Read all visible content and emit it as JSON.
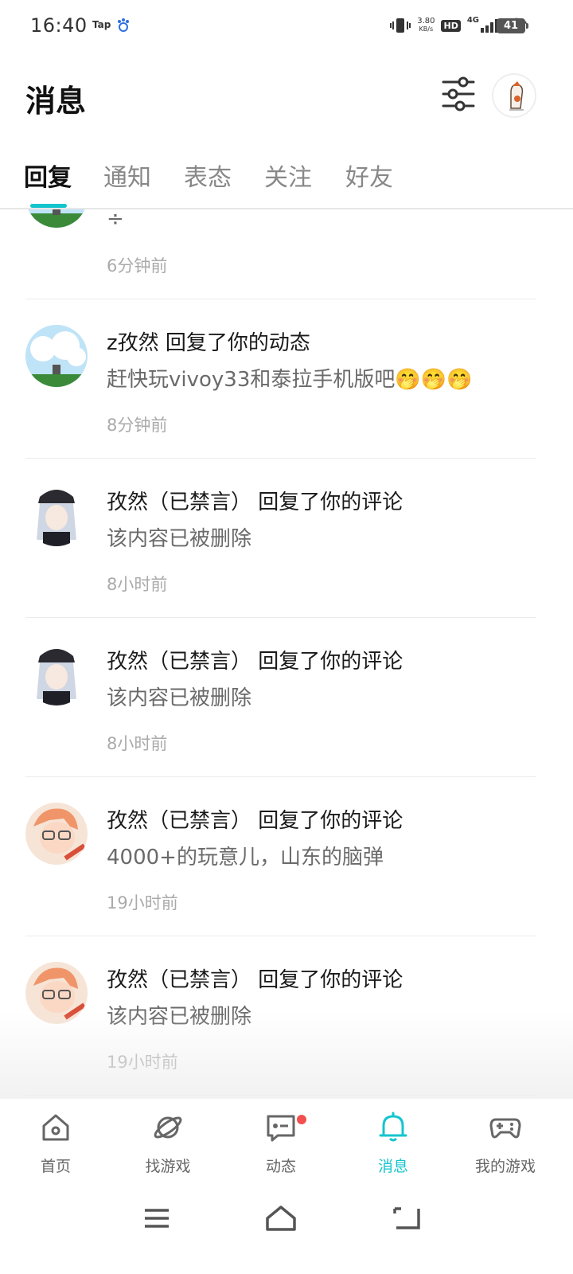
{
  "status_bar": {
    "time": "16:40",
    "tap_label": "Tap",
    "speed_value": "3.80",
    "speed_unit": "KB/s",
    "hd": "HD",
    "network": "4G",
    "battery": "41"
  },
  "header": {
    "title": "消息"
  },
  "tabs": [
    "回复",
    "通知",
    "表态",
    "关注",
    "好友"
  ],
  "messages": [
    {
      "title": "",
      "body": "÷",
      "time": "6分钟前"
    },
    {
      "title": "z孜然 回复了你的动态",
      "body": "赶快玩vivoy33和泰拉手机版吧🤭🤭🤭",
      "time": "8分钟前"
    },
    {
      "title": "孜然（已禁言） 回复了你的评论",
      "body": "该内容已被删除",
      "time": "8小时前"
    },
    {
      "title": "孜然（已禁言） 回复了你的评论",
      "body": "该内容已被删除",
      "time": "8小时前"
    },
    {
      "title": "孜然（已禁言） 回复了你的评论",
      "body": "4000+的玩意儿，山东的脑弹",
      "time": "19小时前"
    },
    {
      "title": "孜然（已禁言） 回复了你的评论",
      "body": "该内容已被删除",
      "time": "19小时前"
    }
  ],
  "bottom_nav": [
    {
      "label": "首页",
      "icon": "home-icon"
    },
    {
      "label": "找游戏",
      "icon": "planet-icon"
    },
    {
      "label": "动态",
      "icon": "chat-icon"
    },
    {
      "label": "消息",
      "icon": "bell-icon"
    },
    {
      "label": "我的游戏",
      "icon": "gamepad-icon"
    }
  ],
  "colors": {
    "accent": "#15c5ce",
    "badge": "#f2504f"
  }
}
